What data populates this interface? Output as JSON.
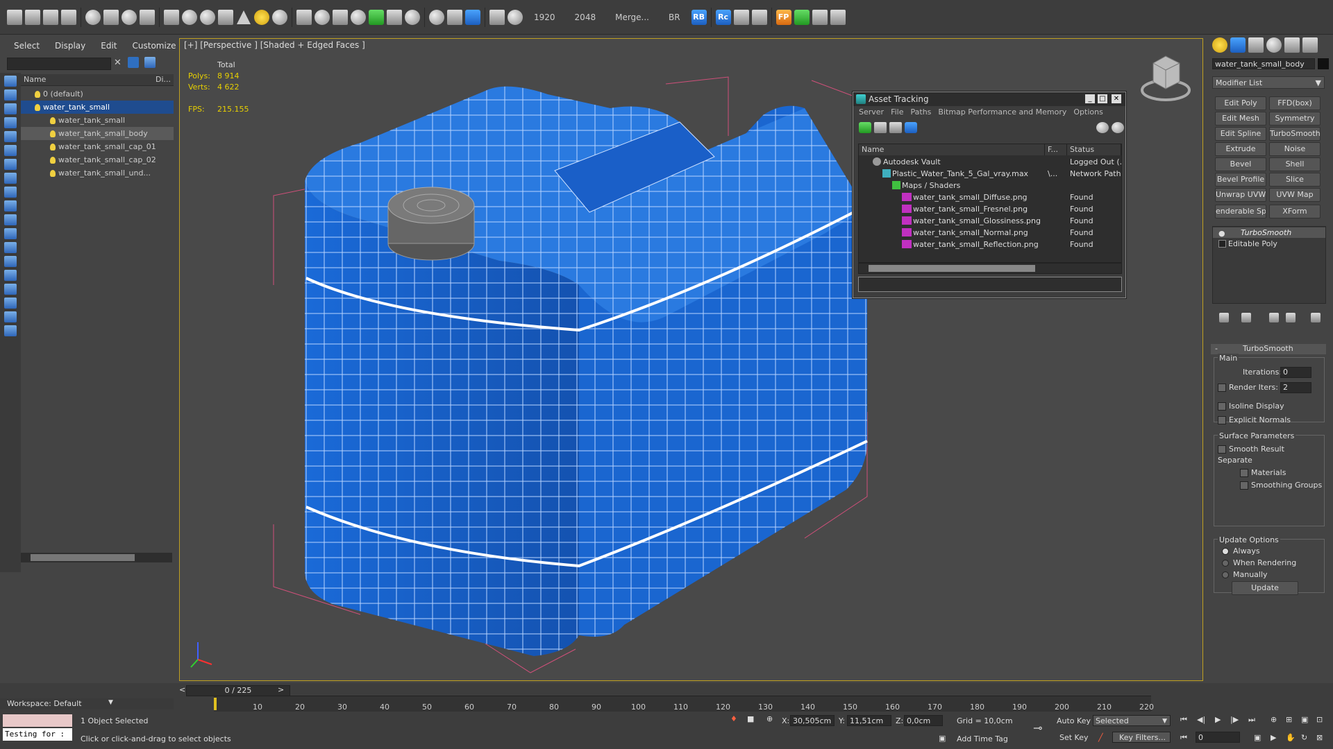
{
  "toolbar": {
    "resolution_w": "1920",
    "resolution_h": "2048",
    "merge_label": "Merge...",
    "br_label": "BR",
    "rb_label": "RB",
    "rc_label": "Rc",
    "fp_label": "FP"
  },
  "scene_explorer": {
    "menu": [
      "Select",
      "Display",
      "Edit",
      "Customize"
    ],
    "col_name": "Name",
    "col_di": "Di...",
    "rows": [
      "0 (default)",
      "water_tank_small",
      "water_tank_small",
      "water_tank_small_body",
      "water_tank_small_cap_01",
      "water_tank_small_cap_02",
      "water_tank_small_und..."
    ]
  },
  "viewport": {
    "label": "[+] [Perspective ] [Shaded + Edged Faces ]",
    "stats_total": "Total",
    "polys_label": "Polys:",
    "polys_value": "8 914",
    "verts_label": "Verts:",
    "verts_value": "4 622",
    "fps_label": "FPS:",
    "fps_value": "215.155"
  },
  "asset_tracking": {
    "title": "Asset Tracking",
    "menu": [
      "Server",
      "File",
      "Paths",
      "Bitmap Performance and Memory",
      "Options"
    ],
    "col_name": "Name",
    "col_f": "F...",
    "col_status": "Status",
    "rows": [
      {
        "name": "Autodesk Vault",
        "f": "",
        "status": "Logged Out (..."
      },
      {
        "name": "Plastic_Water_Tank_5_Gal_vray.max",
        "f": "\\...",
        "status": "Network Path"
      },
      {
        "name": "Maps / Shaders",
        "f": "",
        "status": ""
      },
      {
        "name": "water_tank_small_Diffuse.png",
        "f": "",
        "status": "Found"
      },
      {
        "name": "water_tank_small_Fresnel.png",
        "f": "",
        "status": "Found"
      },
      {
        "name": "water_tank_small_Glossiness.png",
        "f": "",
        "status": "Found"
      },
      {
        "name": "water_tank_small_Normal.png",
        "f": "",
        "status": "Found"
      },
      {
        "name": "water_tank_small_Reflection.png",
        "f": "",
        "status": "Found"
      }
    ]
  },
  "command_panel": {
    "object_name": "water_tank_small_body",
    "modifier_list": "Modifier List",
    "buttons": [
      [
        "Edit Poly",
        "FFD(box)"
      ],
      [
        "Edit Mesh",
        "Symmetry"
      ],
      [
        "Edit Spline",
        "TurboSmooth"
      ],
      [
        "Extrude",
        "Noise"
      ],
      [
        "Bevel",
        "Shell"
      ],
      [
        "Bevel Profile",
        "Slice"
      ],
      [
        "Unwrap UVW",
        "UVW Map"
      ],
      [
        "enderable Splir",
        "XForm"
      ]
    ],
    "stack": [
      "TurboSmooth",
      "Editable Poly"
    ],
    "rollout_title": "TurboSmooth",
    "main_label": "Main",
    "iterations_label": "Iterations:",
    "iterations_value": "0",
    "render_iters_label": "Render Iters:",
    "render_iters_value": "2",
    "isoline_label": "Isoline Display",
    "explicit_normals_label": "Explicit Normals",
    "surface_params_label": "Surface Parameters",
    "smooth_result_label": "Smooth Result",
    "separate_label": "Separate",
    "materials_label": "Materials",
    "smoothing_groups_label": "Smoothing Groups",
    "update_options_label": "Update Options",
    "always_label": "Always",
    "when_rendering_label": "When Rendering",
    "manually_label": "Manually",
    "update_button": "Update"
  },
  "timeline": {
    "frame_counter": "0 / 225",
    "ticks": [
      "10",
      "20",
      "30",
      "40",
      "50",
      "60",
      "70",
      "80",
      "90",
      "100",
      "110",
      "120",
      "130",
      "140",
      "150",
      "160",
      "170",
      "180",
      "190",
      "200",
      "210",
      "220"
    ]
  },
  "status": {
    "workspace": "Workspace: Default",
    "maxscript": "Testing for :",
    "selected": "1 Object Selected",
    "prompt": "Click or click-and-drag to select objects",
    "x_label": "X:",
    "x_value": "30,505cm",
    "y_label": "Y:",
    "y_value": "11,51cm",
    "z_label": "Z:",
    "z_value": "0,0cm",
    "grid": "Grid = 10,0cm",
    "add_time_tag": "Add Time Tag",
    "auto_key": "Auto Key",
    "set_key": "Set Key",
    "selected_dropdown": "Selected",
    "key_filters": "Key Filters...",
    "frame_value": "0"
  }
}
